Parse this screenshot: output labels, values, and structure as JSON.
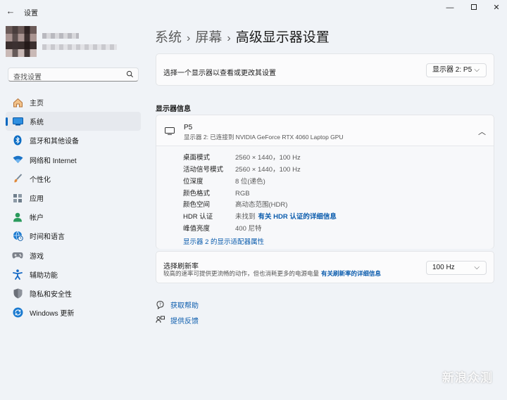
{
  "window": {
    "title": "设置",
    "back_glyph": "←",
    "minimize_glyph": "—",
    "close_glyph": "✕"
  },
  "search": {
    "placeholder": "查找设置",
    "icon": "search-icon"
  },
  "sidebar": {
    "items": [
      {
        "label": "主页",
        "icon": "home-icon",
        "color": "#c4884f"
      },
      {
        "label": "系统",
        "icon": "system-icon",
        "color": "#0a6cc4",
        "active": true
      },
      {
        "label": "蓝牙和其他设备",
        "icon": "bluetooth-icon",
        "color": "#0a6cc4"
      },
      {
        "label": "网络和 Internet",
        "icon": "wifi-icon",
        "color": "#1a73c7"
      },
      {
        "label": "个性化",
        "icon": "brush-icon",
        "color": "#e08a3c"
      },
      {
        "label": "应用",
        "icon": "apps-icon",
        "color": "#5c6b7a"
      },
      {
        "label": "帐户",
        "icon": "account-icon",
        "color": "#2a9a5c"
      },
      {
        "label": "时间和语言",
        "icon": "globe-clock-icon",
        "color": "#1a7ad0"
      },
      {
        "label": "游戏",
        "icon": "gamepad-icon",
        "color": "#6b6f78"
      },
      {
        "label": "辅助功能",
        "icon": "accessibility-icon",
        "color": "#1367c4"
      },
      {
        "label": "隐私和安全性",
        "icon": "shield-icon",
        "color": "#6b6f78"
      },
      {
        "label": "Windows 更新",
        "icon": "update-icon",
        "color": "#1a7ad0"
      }
    ]
  },
  "breadcrumb": {
    "part1": "系统",
    "sep": "›",
    "part2": "屏幕",
    "part3": "高级显示器设置"
  },
  "monitor_select": {
    "label": "选择一个显示器以查看或更改其设置",
    "value": "显示器 2: P5",
    "chevron": "⌵"
  },
  "info_section_title": "显示器信息",
  "monitor": {
    "name": "P5",
    "subtitle": "显示器 2: 已连接到 NVIDIA GeForce RTX 4060 Laptop GPU",
    "collapse_chevron": "︿",
    "rows": [
      {
        "key": "桌面模式",
        "value": "2560 × 1440，100 Hz"
      },
      {
        "key": "活动信号模式",
        "value": "2560 × 1440，100 Hz"
      },
      {
        "key": "位深度",
        "value": "8 位(递色)"
      },
      {
        "key": "颜色格式",
        "value": "RGB"
      },
      {
        "key": "颜色空间",
        "value": "高动态范围(HDR)"
      },
      {
        "key": "HDR 认证",
        "value": "未找到",
        "link": "有关 HDR 认证的详细信息"
      },
      {
        "key": "峰值亮度",
        "value": "400 尼特"
      }
    ],
    "adapter_link": "显示器 2 的显示适配器属性"
  },
  "refresh": {
    "label": "选择刷新率",
    "sub": "较高的速率可提供更流畅的动作，但也消耗更多的电源电量",
    "link": "有关刷新率的详细信息",
    "value": "100 Hz",
    "chevron": "⌵"
  },
  "help": {
    "get_help": "获取帮助",
    "feedback": "提供反馈"
  },
  "watermark": "新浪众测"
}
